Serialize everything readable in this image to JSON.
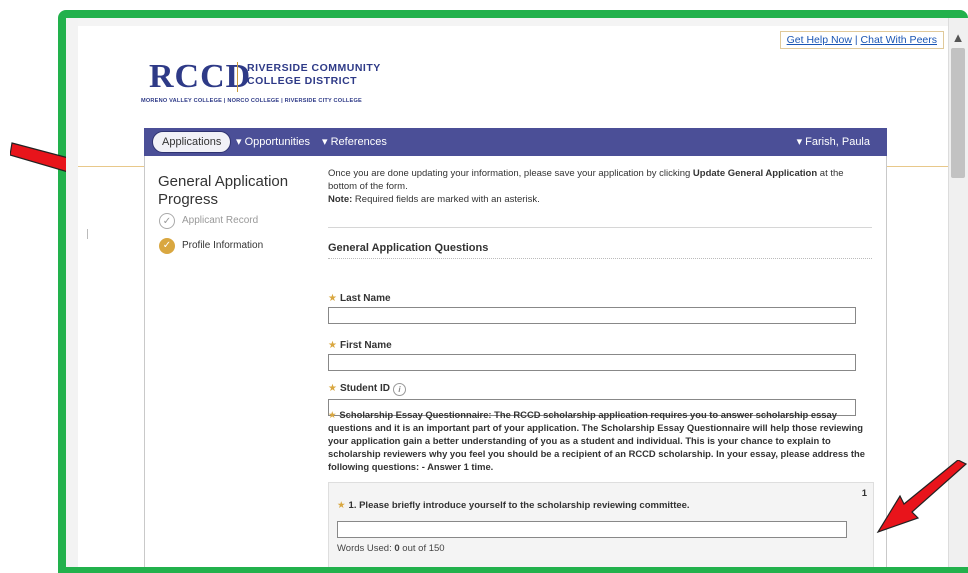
{
  "header": {
    "help_link": "Get Help Now",
    "separator": "|",
    "chat_link": "Chat With Peers"
  },
  "logo": {
    "acronym": "RCCD",
    "name_line1": "RIVERSIDE COMMUNITY",
    "name_line2": "COLLEGE DISTRICT",
    "colleges": "MORENO VALLEY COLLEGE | NORCO COLLEGE | RIVERSIDE CITY COLLEGE"
  },
  "nav": {
    "applications": "Applications",
    "opportunities": "▾ Opportunities",
    "references": "▾ References",
    "user": "▾ Farish, Paula"
  },
  "sidebar": {
    "title": "General Application Progress",
    "steps": [
      {
        "label": "Applicant Record",
        "state": "incomplete"
      },
      {
        "label": "Profile Information",
        "state": "current"
      }
    ]
  },
  "main": {
    "intro_part1": "Once you are done updating your information, please save your application by clicking ",
    "intro_bold": "Update General Application",
    "intro_part2": " at the bottom of the form.",
    "note_label": "Note:",
    "note_text": " Required fields are marked with an asterisk.",
    "section_title": "General Application Questions",
    "fields": {
      "last_name": {
        "label": "Last Name",
        "value": ""
      },
      "first_name": {
        "label": "First Name",
        "value": ""
      },
      "student_id": {
        "label": "Student ID",
        "value": ""
      }
    },
    "essay_prompt": "Scholarship Essay Questionnaire: The RCCD scholarship application requires you to answer scholarship essay questions and it is an important part of your application. The Scholarship Essay Questionnaire will help those reviewing your application gain a better understanding of you as a student and individual. This is your chance to explain to scholarship reviewers why you feel you should be a recipient of an RCCD scholarship. In your essay, please address the following questions: - Answer 1 time.",
    "question": {
      "number": "1",
      "text": "1. Please briefly introduce yourself to the scholarship reviewing committee.",
      "value": "",
      "words_prefix": "Words Used: ",
      "words_used": "0",
      "words_suffix": " out of 150"
    }
  },
  "colors": {
    "frame_green": "#22b14c",
    "nav_purple": "#4b4f97",
    "accent_gold": "#d9a740",
    "arrow_red": "#e8141b",
    "link_blue": "#1a55b4"
  }
}
